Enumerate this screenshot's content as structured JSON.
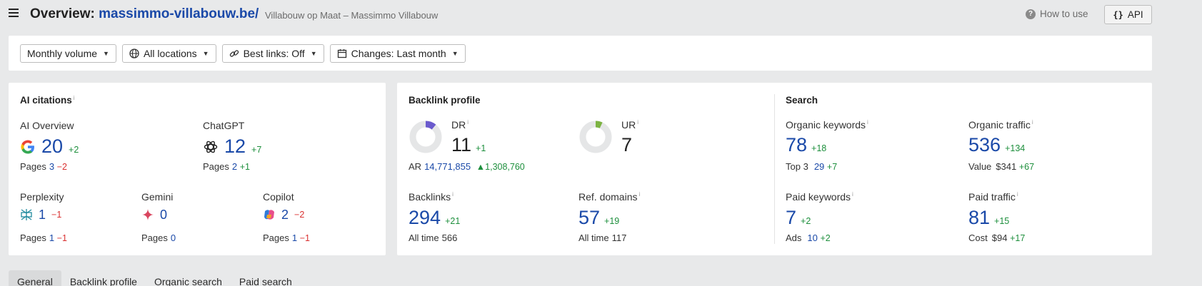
{
  "header": {
    "title_prefix": "Overview:",
    "domain": "massimmo-villabouw.be/",
    "subtitle": "Villabouw op Maat – Massimmo Villabouw",
    "how_to_use": "How to use",
    "api_label": "API",
    "api_brace": "{}"
  },
  "filters": [
    {
      "label": "Monthly volume",
      "icon": "none"
    },
    {
      "label": "All locations",
      "icon": "globe-icon"
    },
    {
      "label": "Best links: Off",
      "icon": "link-icon"
    },
    {
      "label": "Changes: Last month",
      "icon": "calendar-icon"
    }
  ],
  "ai_citations": {
    "title": "AI citations",
    "info": "i",
    "overview": {
      "label": "AI Overview",
      "value": "20",
      "delta": "+2",
      "pages_label": "Pages",
      "pages": "3",
      "pages_delta": "−2"
    },
    "chatgpt": {
      "label": "ChatGPT",
      "value": "12",
      "delta": "+7",
      "pages_label": "Pages",
      "pages": "2",
      "pages_delta": "+1"
    },
    "perplexity": {
      "label": "Perplexity",
      "value": "1",
      "delta": "−1",
      "pages_label": "Pages",
      "pages": "1",
      "pages_delta": "−1"
    },
    "gemini": {
      "label": "Gemini",
      "value": "0",
      "pages_label": "Pages",
      "pages": "0"
    },
    "copilot": {
      "label": "Copilot",
      "value": "2",
      "delta": "−2",
      "pages_label": "Pages",
      "pages": "1",
      "pages_delta": "−1"
    }
  },
  "backlink_profile": {
    "title": "Backlink profile",
    "dr": {
      "label": "DR",
      "value": "11",
      "delta": "+1",
      "gauge_fraction": 0.11,
      "gauge_color": "#6a5acd"
    },
    "ar": {
      "label": "AR",
      "value": "14,771,855",
      "delta": "1,308,760"
    },
    "ur": {
      "label": "UR",
      "value": "7",
      "gauge_fraction": 0.07,
      "gauge_color": "#7cb342"
    },
    "backlinks": {
      "label": "Backlinks",
      "value": "294",
      "delta": "+21",
      "all_time_label": "All time",
      "all_time": "566"
    },
    "ref_domains": {
      "label": "Ref. domains",
      "value": "57",
      "delta": "+19",
      "all_time_label": "All time",
      "all_time": "117"
    }
  },
  "search": {
    "title": "Search",
    "organic_keywords": {
      "label": "Organic keywords",
      "value": "78",
      "delta": "+18",
      "sub_label": "Top 3",
      "sub_value": "29",
      "sub_delta": "+7"
    },
    "organic_traffic": {
      "label": "Organic traffic",
      "value": "536",
      "delta": "+134",
      "sub_label": "Value",
      "sub_value": "$341",
      "sub_delta": "+67"
    },
    "paid_keywords": {
      "label": "Paid keywords",
      "value": "7",
      "delta": "+2",
      "sub_label": "Ads",
      "sub_value": "10",
      "sub_delta": "+2"
    },
    "paid_traffic": {
      "label": "Paid traffic",
      "value": "81",
      "delta": "+15",
      "sub_label": "Cost",
      "sub_value": "$94",
      "sub_delta": "+17"
    }
  },
  "tabs": [
    "General",
    "Backlink profile",
    "Organic search",
    "Paid search"
  ],
  "colors": {
    "accent": "#1a49a8",
    "positive": "#1d8f3c",
    "negative": "#d93030"
  }
}
